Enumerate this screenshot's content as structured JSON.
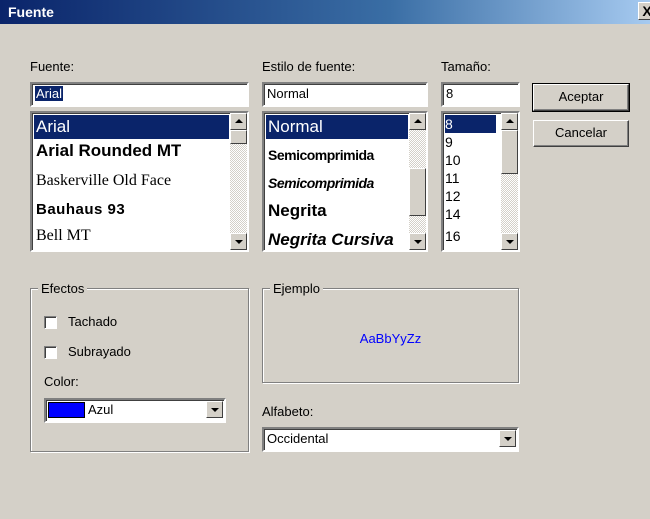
{
  "window": {
    "title": "Fuente",
    "close_label": "X"
  },
  "font": {
    "label": "Fuente:",
    "value": "Arial",
    "items": [
      "Arial",
      "Arial Rounded MT",
      "Baskerville Old Face",
      "Bauhaus 93",
      "Bell MT"
    ]
  },
  "style": {
    "label": "Estilo de fuente:",
    "value": "Normal",
    "items": [
      "Normal",
      "Semicomprimida",
      "Semicomprimida",
      "Negrita",
      "Negrita Cursiva"
    ]
  },
  "size": {
    "label": "Tamaño:",
    "value": "8",
    "items": [
      "8",
      "9",
      "10",
      "11",
      "12",
      "14",
      "16"
    ]
  },
  "buttons": {
    "ok": "Aceptar",
    "cancel": "Cancelar"
  },
  "effects": {
    "legend": "Efectos",
    "strikeout": "Tachado",
    "underline": "Subrayado",
    "color_label": "Color:",
    "color_value": "Azul",
    "color_swatch": "#0000ff"
  },
  "sample": {
    "legend": "Ejemplo",
    "text": "AaBbYyZz",
    "color": "#0000ff"
  },
  "script": {
    "label": "Alfabeto:",
    "value": "Occidental"
  }
}
